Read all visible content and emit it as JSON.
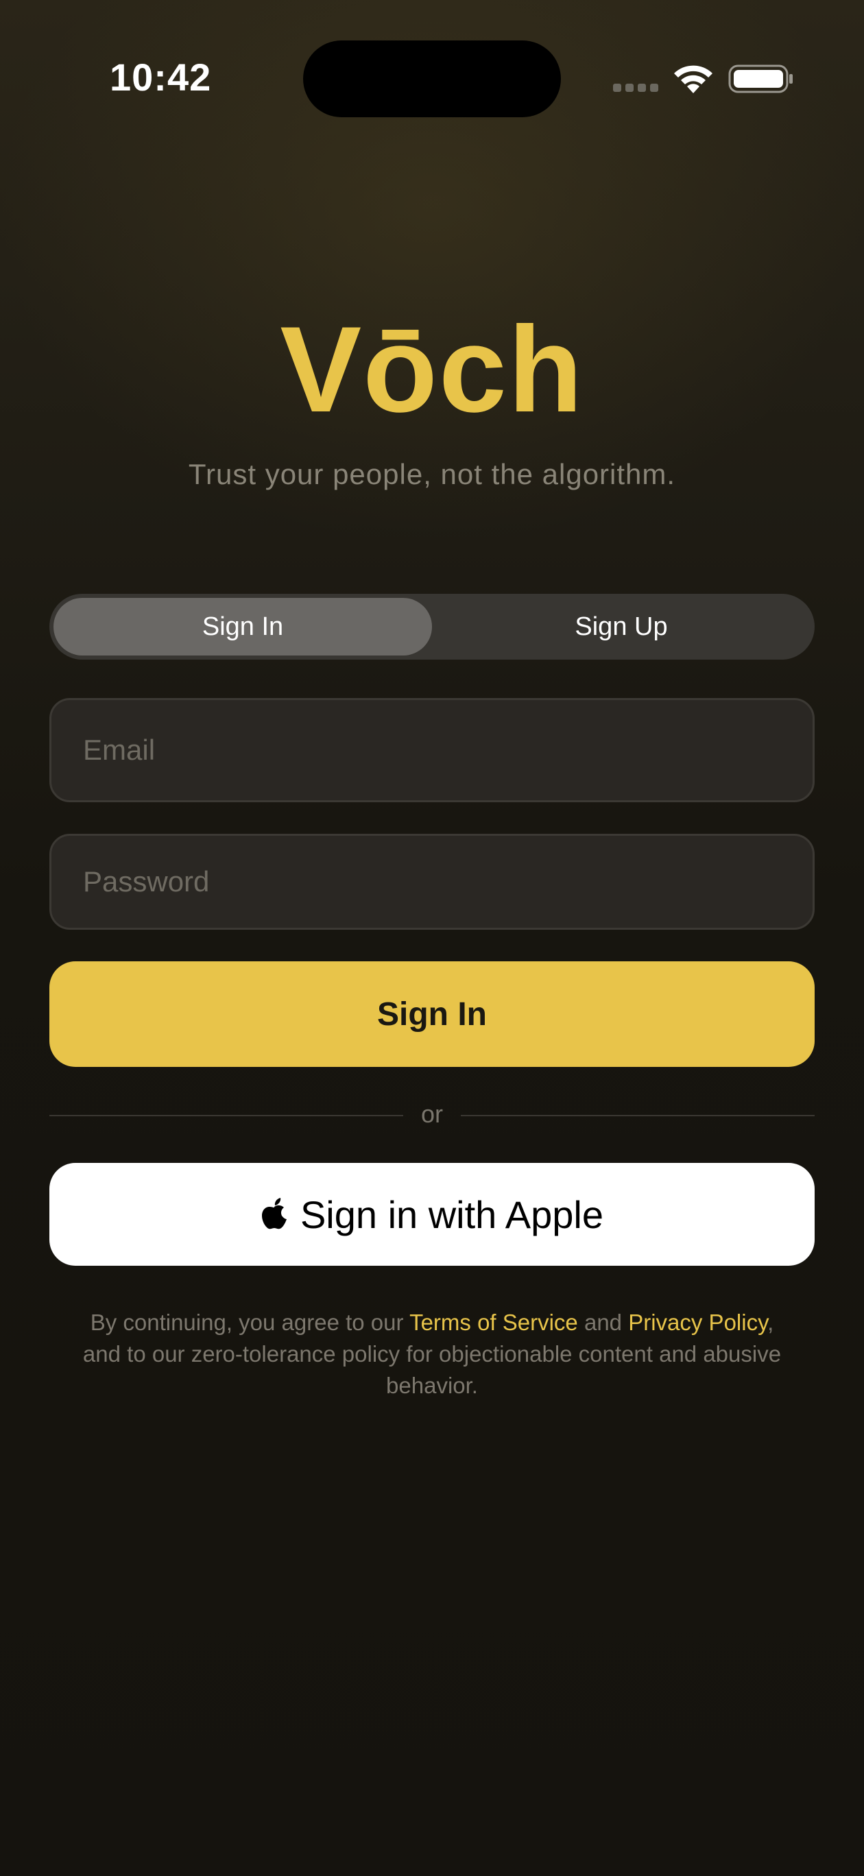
{
  "status_bar": {
    "time": "10:42"
  },
  "brand": {
    "logo": "Vōch",
    "tagline": "Trust your people, not the algorithm.",
    "accent_color": "#e8c44a"
  },
  "auth_tabs": {
    "selected": "Sign In",
    "items": [
      {
        "label": "Sign In"
      },
      {
        "label": "Sign Up"
      }
    ]
  },
  "form": {
    "email_placeholder": "Email",
    "email_value": "",
    "password_placeholder": "Password",
    "password_value": "",
    "submit_label": "Sign In"
  },
  "divider": {
    "label": "or"
  },
  "apple": {
    "icon": "apple-logo-icon",
    "label": "Sign in with Apple"
  },
  "legal": {
    "prefix": "By continuing, you agree to our ",
    "terms_link": "Terms of Service",
    "middle": " and ",
    "privacy_link": "Privacy Policy",
    "suffix": ", and to our zero-tolerance policy for objectionable content and abusive behavior."
  }
}
